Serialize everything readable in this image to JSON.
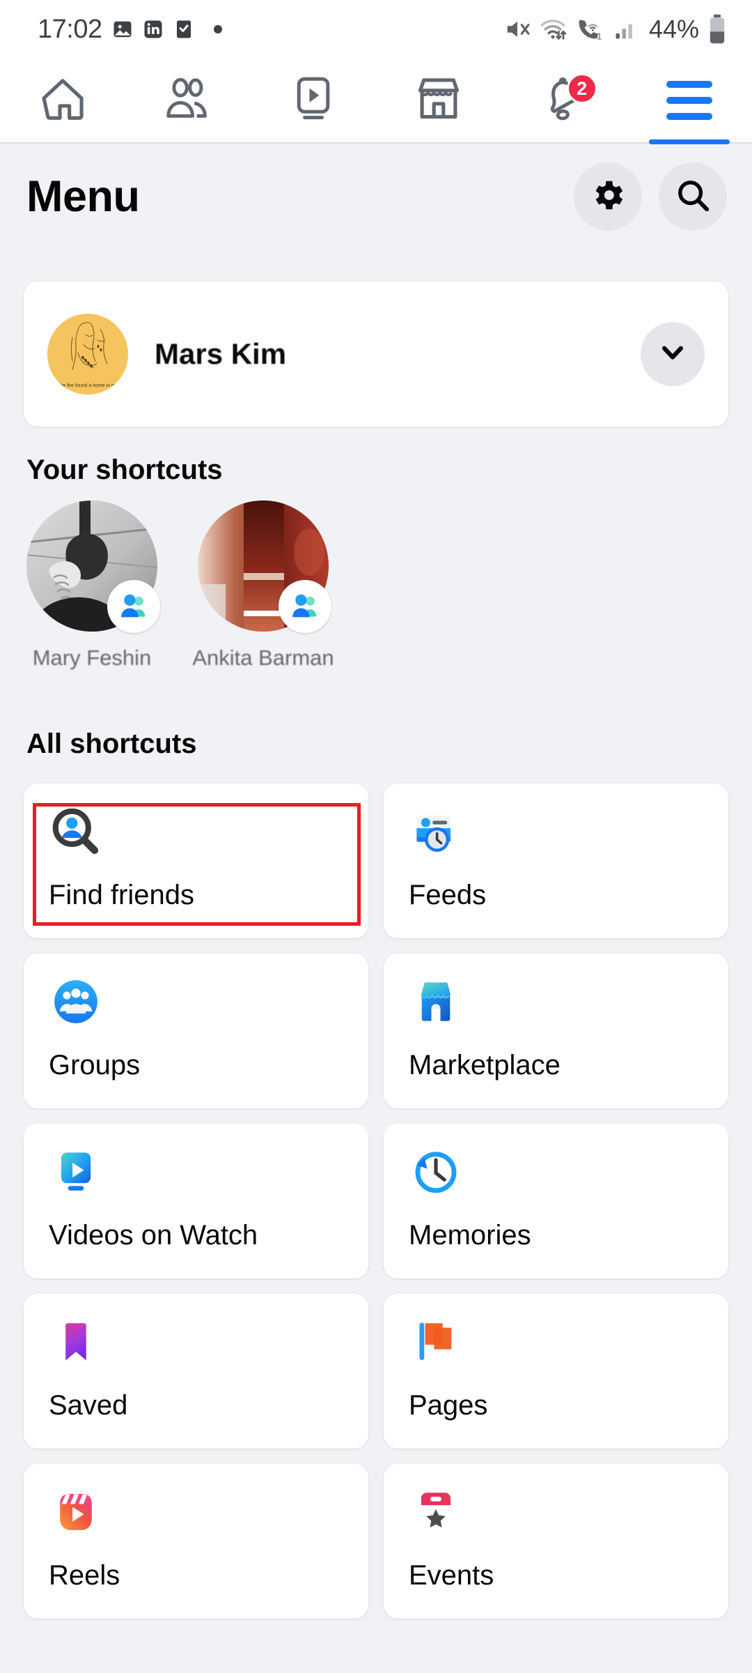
{
  "status_bar": {
    "time": "17:02",
    "left_icons": [
      "photo-icon",
      "linkedin-icon",
      "tasks-icon",
      "dot-icon"
    ],
    "right_icons": [
      "mute-icon",
      "wifi-transfer-icon",
      "wifi-calling-icon",
      "signal-bars-icon"
    ],
    "battery_percent": "44%"
  },
  "top_nav": {
    "tabs": [
      {
        "name": "home",
        "icon": "home-icon",
        "badge": null,
        "active": false
      },
      {
        "name": "friends",
        "icon": "friends-icon",
        "badge": null,
        "active": false
      },
      {
        "name": "video",
        "icon": "video-play-icon",
        "badge": null,
        "active": false
      },
      {
        "name": "marketplace",
        "icon": "storefront-icon",
        "badge": null,
        "active": false
      },
      {
        "name": "notifications",
        "icon": "bell-icon",
        "badge": "2",
        "active": false
      },
      {
        "name": "menu",
        "icon": "hamburger-icon",
        "badge": null,
        "active": true
      }
    ],
    "accent_color": "#1877F2",
    "badge_color": "#F02849"
  },
  "header": {
    "title": "Menu",
    "settings_icon": "gear-icon",
    "search_icon": "search-icon"
  },
  "profile": {
    "name": "Mars Kim",
    "avatar_caption": "The fire found a home in me",
    "avatar_color": "#F5C45E",
    "expand_icon": "chevron-down-icon"
  },
  "your_shortcuts": {
    "title": "Your shortcuts",
    "items": [
      {
        "name": "Mary Feshin",
        "badge_icon": "group-badge-icon"
      },
      {
        "name": "Ankita Barman",
        "badge_icon": "group-badge-icon"
      }
    ]
  },
  "all_shortcuts": {
    "title": "All shortcuts",
    "highlight_color": "#ED1C24",
    "items": [
      {
        "label": "Find friends",
        "icon": "find-friends-icon",
        "highlighted": true
      },
      {
        "label": "Feeds",
        "icon": "feeds-icon",
        "highlighted": false
      },
      {
        "label": "Groups",
        "icon": "groups-icon",
        "highlighted": false
      },
      {
        "label": "Marketplace",
        "icon": "marketplace-icon",
        "highlighted": false
      },
      {
        "label": "Videos on Watch",
        "icon": "videos-watch-icon",
        "highlighted": false
      },
      {
        "label": "Memories",
        "icon": "memories-icon",
        "highlighted": false
      },
      {
        "label": "Saved",
        "icon": "saved-bookmark-icon",
        "highlighted": false
      },
      {
        "label": "Pages",
        "icon": "pages-flag-icon",
        "highlighted": false
      },
      {
        "label": "Reels",
        "icon": "reels-icon",
        "highlighted": false
      },
      {
        "label": "Events",
        "icon": "events-calendar-icon",
        "highlighted": false
      }
    ]
  }
}
